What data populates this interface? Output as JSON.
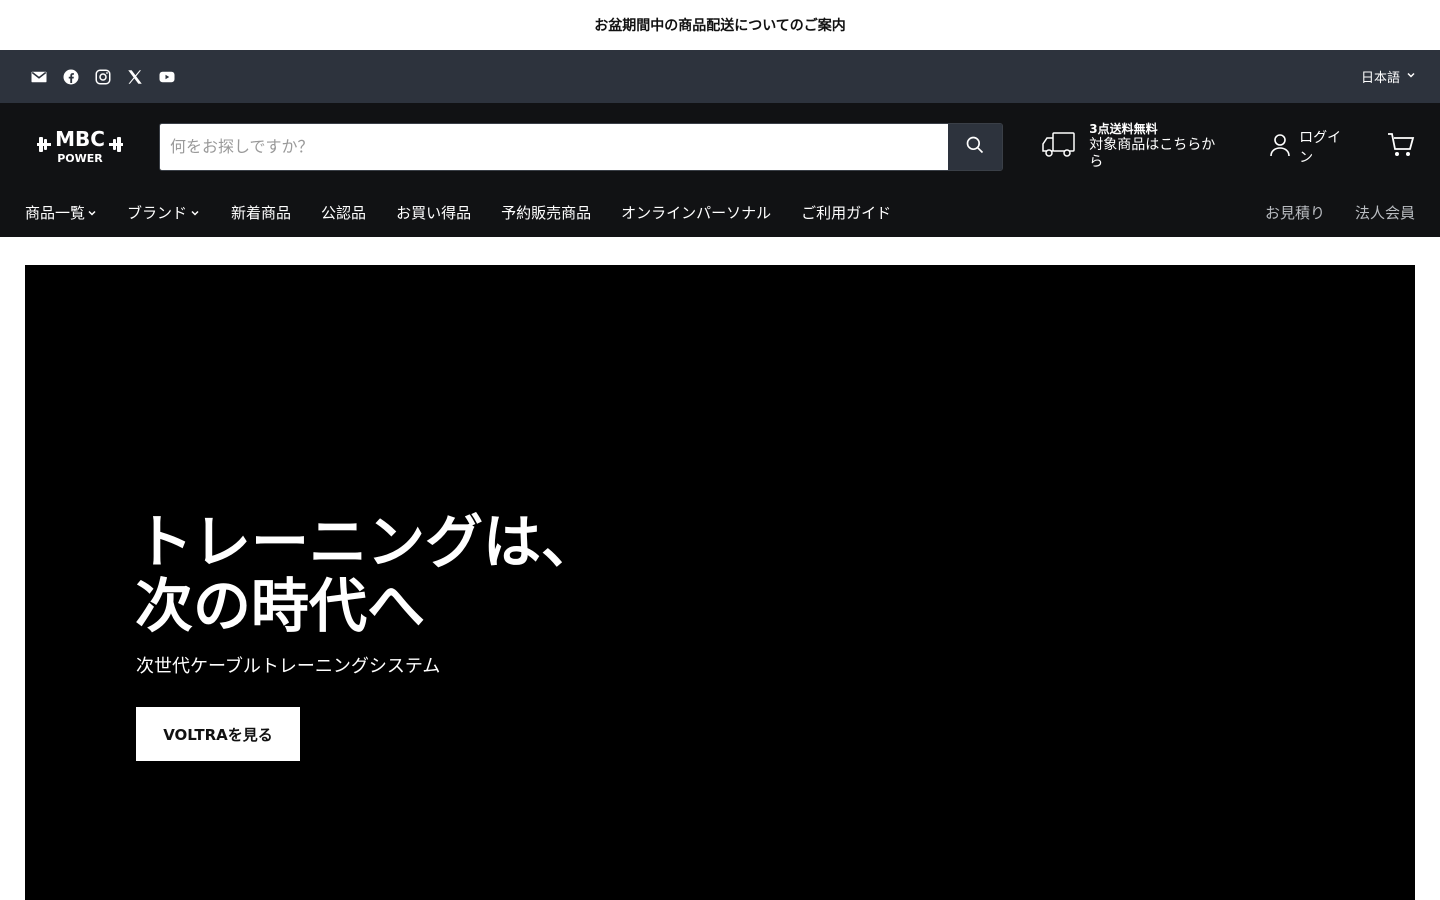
{
  "announcement": {
    "text": "お盆期間中の商品配送についてのご案内"
  },
  "utility_bar": {
    "social_icons": [
      "mail-icon",
      "facebook-icon",
      "instagram-icon",
      "x-icon",
      "youtube-icon"
    ],
    "language": "日本語"
  },
  "header": {
    "logo": {
      "line1": "MBC",
      "line2": "POWER"
    },
    "search": {
      "placeholder": "何をお探しですか？"
    },
    "shipping": {
      "line1": "3点送料無料",
      "line2": "対象商品はこちらから"
    },
    "login_label": "ログイン"
  },
  "nav": {
    "left": [
      {
        "label": "商品一覧",
        "has_dropdown": true
      },
      {
        "label": "ブランド",
        "has_dropdown": true
      },
      {
        "label": "新着商品"
      },
      {
        "label": "公認品"
      },
      {
        "label": "お買い得品"
      },
      {
        "label": "予約販売商品"
      },
      {
        "label": "オンラインパーソナル"
      },
      {
        "label": "ご利用ガイド"
      }
    ],
    "right": [
      {
        "label": "お見積り"
      },
      {
        "label": "法人会員"
      }
    ]
  },
  "hero": {
    "title_line1": "トレーニングは、",
    "title_line2": "次の時代へ",
    "subtitle": "次世代ケーブルトレーニングシステム",
    "button_label": "VOLTRAを見る"
  },
  "colors": {
    "utility_bg": "#2d333d",
    "header_bg": "#111214",
    "hero_bg": "#000000",
    "search_button_bg": "#2d333d"
  }
}
